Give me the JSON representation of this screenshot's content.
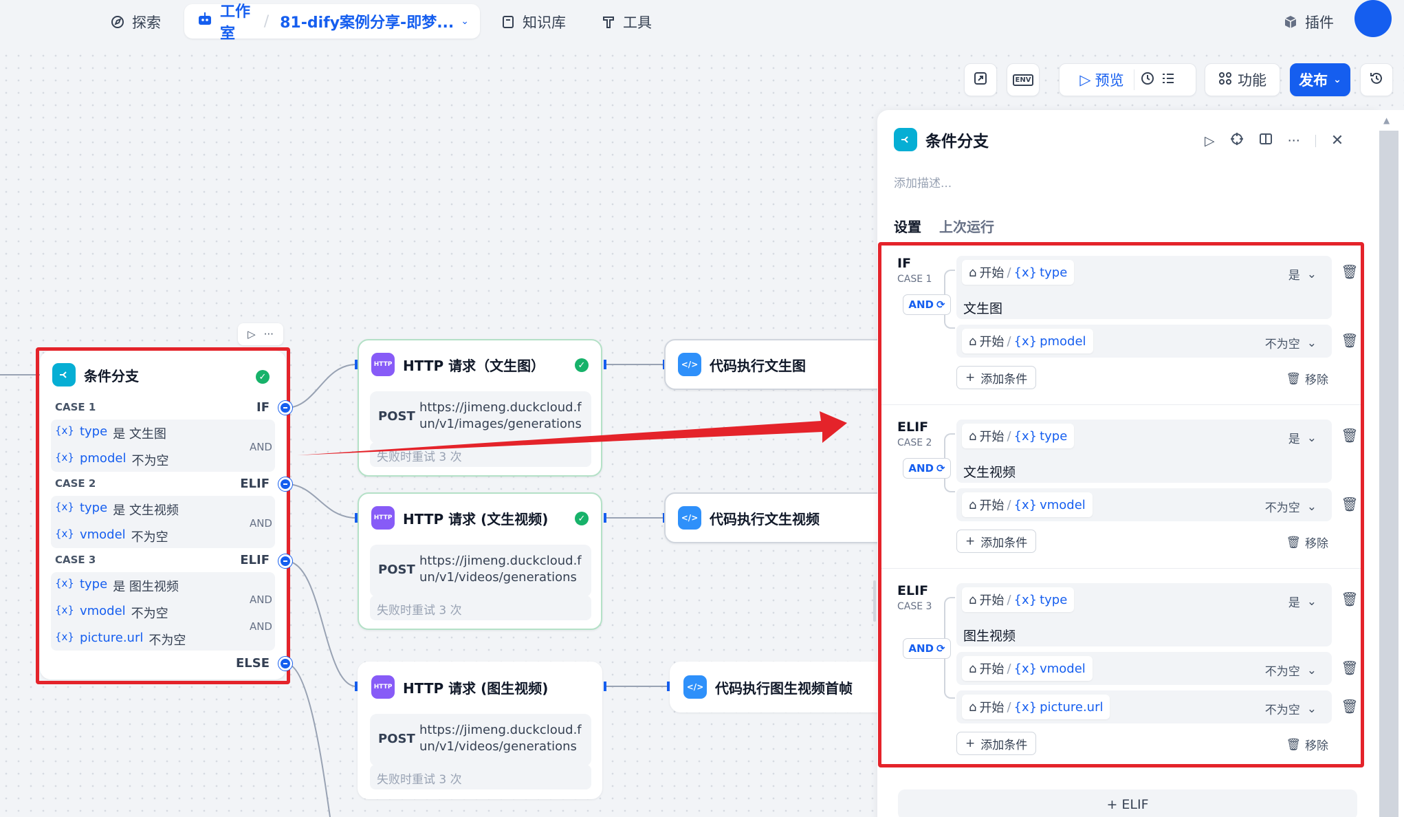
{
  "nav": {
    "explore": "探索",
    "studio": "工作室",
    "app_name": "81-dify案例分享-即梦...",
    "knowledge": "知识库",
    "tools": "工具",
    "plugins": "插件"
  },
  "toolbar": {
    "env": "ENV",
    "preview": "预览",
    "features": "功能",
    "publish": "发布"
  },
  "canvas": {
    "if_node": {
      "title": "条件分支",
      "cases": [
        {
          "label": "CASE 1",
          "keyword": "IF",
          "conditions": [
            {
              "var": "type",
              "op": "是 文生图"
            },
            {
              "var": "pmodel",
              "op": "不为空"
            }
          ],
          "logic": "AND"
        },
        {
          "label": "CASE 2",
          "keyword": "ELIF",
          "conditions": [
            {
              "var": "type",
              "op": "是 文生视频"
            },
            {
              "var": "vmodel",
              "op": "不为空"
            }
          ],
          "logic": "AND"
        },
        {
          "label": "CASE 3",
          "keyword": "ELIF",
          "conditions": [
            {
              "var": "type",
              "op": "是 图生视频"
            },
            {
              "var": "vmodel",
              "op": "不为空"
            },
            {
              "var": "picture.url",
              "op": "不为空"
            }
          ],
          "logic": "AND"
        }
      ],
      "else": "ELSE"
    },
    "http_nodes": [
      {
        "title": "HTTP 请求（文生图）",
        "method": "POST",
        "url": "https://jimeng.duckcloud.fun/v1/images/generations",
        "retry": "失败时重试 3 次"
      },
      {
        "title": "HTTP 请求 (文生视频)",
        "method": "POST",
        "url": "https://jimeng.duckcloud.fun/v1/videos/generations",
        "retry": "失败时重试 3 次"
      },
      {
        "title": "HTTP 请求 (图生视频)",
        "method": "POST",
        "url": "https://jimeng.duckcloud.fun/v1/videos/generations",
        "retry": "失败时重试 3 次"
      }
    ],
    "code_nodes": [
      {
        "title": "代码执行文生图"
      },
      {
        "title": "代码执行文生视频"
      },
      {
        "title": "代码执行图生视频首帧"
      }
    ]
  },
  "panel": {
    "title": "条件分支",
    "description_placeholder": "添加描述...",
    "tabs": [
      "设置",
      "上次运行"
    ],
    "source": "开始",
    "add_condition": "添加条件",
    "remove": "移除",
    "add_elif": "+ ELIF",
    "cases": [
      {
        "keyword": "IF",
        "label": "CASE 1",
        "logic": "AND",
        "conditions": [
          {
            "var": "type",
            "op": "是",
            "value": "文生图"
          },
          {
            "var": "pmodel",
            "op": "不为空"
          }
        ]
      },
      {
        "keyword": "ELIF",
        "label": "CASE 2",
        "logic": "AND",
        "conditions": [
          {
            "var": "type",
            "op": "是",
            "value": "文生视频"
          },
          {
            "var": "vmodel",
            "op": "不为空"
          }
        ]
      },
      {
        "keyword": "ELIF",
        "label": "CASE 3",
        "logic": "AND",
        "conditions": [
          {
            "var": "type",
            "op": "是",
            "value": "图生视频"
          },
          {
            "var": "vmodel",
            "op": "不为空"
          },
          {
            "var": "picture.url",
            "op": "不为空"
          }
        ]
      }
    ]
  },
  "colors": {
    "accent": "#155eef",
    "highlight_red": "#e4232a",
    "success": "#17b26a"
  }
}
